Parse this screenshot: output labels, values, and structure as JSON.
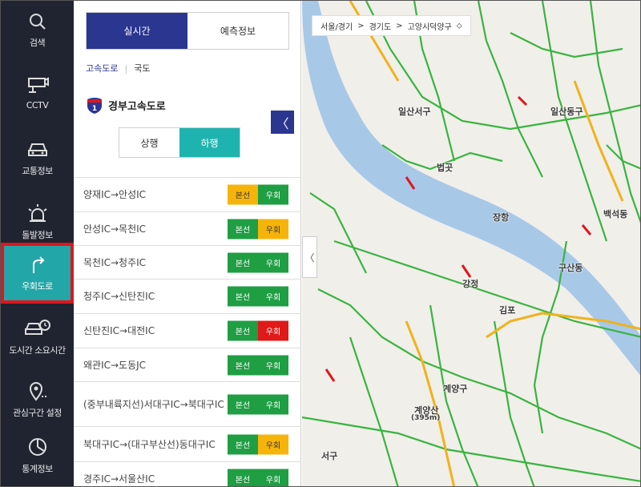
{
  "nav": {
    "items": [
      {
        "label": "검색",
        "icon": "search-icon"
      },
      {
        "label": "CCTV",
        "icon": "cctv-icon"
      },
      {
        "label": "교통정보",
        "icon": "car-icon"
      },
      {
        "label": "돌발정보",
        "icon": "alert-light-icon"
      },
      {
        "label": "우회도로",
        "icon": "detour-icon",
        "active": true
      },
      {
        "label": "도시간 소요시간",
        "icon": "car-clock-icon"
      },
      {
        "label": "관심구간 설정",
        "icon": "location-pin-icon"
      },
      {
        "label": "통계정보",
        "icon": "chart-icon"
      }
    ]
  },
  "panel": {
    "tabs": {
      "realtime": "실시간",
      "forecast": "예측정보"
    },
    "subtabs": {
      "expressway": "고속도로",
      "national": "국도"
    },
    "route_number": "1",
    "route_title": "경부고속도로",
    "collapse_label": "〈",
    "direction": {
      "up": "상행",
      "down": "하행"
    },
    "labels": {
      "main": "본선",
      "detour": "우회"
    },
    "rows": [
      {
        "name": "양재IC→안성IC",
        "main": "yellow",
        "detour": "green"
      },
      {
        "name": "안성IC→목천IC",
        "main": "green",
        "detour": "yellow"
      },
      {
        "name": "목천IC→청주IC",
        "main": "green",
        "detour": "green"
      },
      {
        "name": "청주IC→신탄진IC",
        "main": "green",
        "detour": "green"
      },
      {
        "name": "신탄진IC→대전IC",
        "main": "green",
        "detour": "red"
      },
      {
        "name": "왜관IC→도동JC",
        "main": "green",
        "detour": "green"
      },
      {
        "name": "(중부내륙지선)서대구IC→북대구IC",
        "main": "green",
        "detour": "green"
      },
      {
        "name": "북대구IC→(대구부산선)동대구IC",
        "main": "green",
        "detour": "yellow"
      },
      {
        "name": "경주IC→서울산IC",
        "main": "green",
        "detour": "green"
      }
    ]
  },
  "map": {
    "breadcrumb": [
      "서울/경기",
      "경기도",
      "고양시덕양구"
    ],
    "toggle_label": "〈",
    "place_labels": [
      "일산서구",
      "일산동구",
      "법곳",
      "장항",
      "백석동",
      "구산동",
      "김포",
      "강정",
      "계양구",
      "계양산",
      "(395m)",
      "서구"
    ]
  },
  "colors": {
    "nav_bg": "#1f2430",
    "nav_active": "#23a6a8",
    "highlight": "#e0161d",
    "tab_active": "#2b3691",
    "dir_active": "#1fb3b0",
    "green": "#1f9e43",
    "yellow": "#f6b40b",
    "red": "#e01919"
  }
}
